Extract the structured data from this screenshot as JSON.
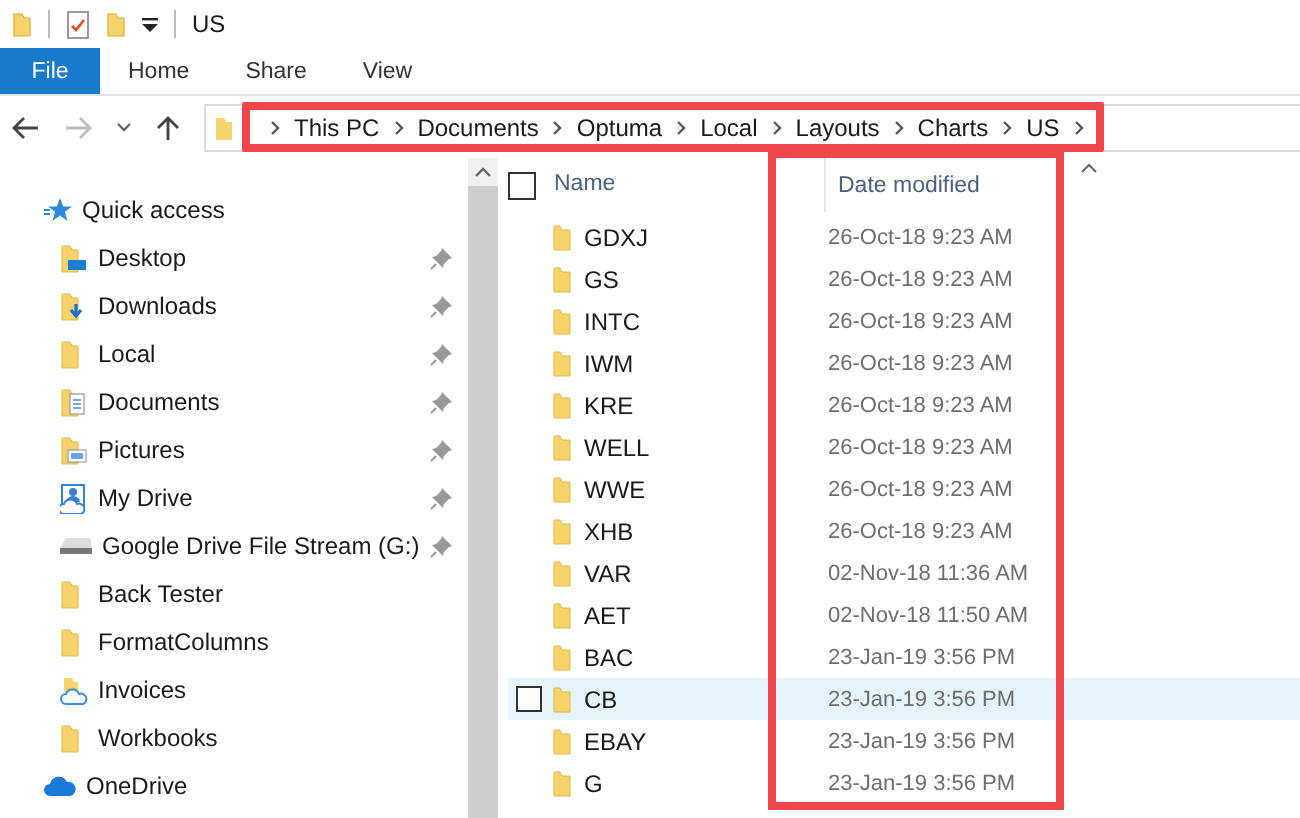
{
  "window": {
    "title": "US"
  },
  "ribbon_tabs": [
    {
      "label": "File",
      "selected": true
    },
    {
      "label": "Home",
      "selected": false
    },
    {
      "label": "Share",
      "selected": false
    },
    {
      "label": "View",
      "selected": false
    }
  ],
  "address_bar": {
    "highlighted": true,
    "segments": [
      "This PC",
      "Documents",
      "Optuma",
      "Local",
      "Layouts",
      "Charts",
      "US"
    ]
  },
  "sidebar": {
    "items": [
      {
        "label": "Quick access",
        "kind": "star",
        "children": [
          {
            "label": "Desktop",
            "kind": "desktop",
            "pinned": true
          },
          {
            "label": "Downloads",
            "kind": "downloads",
            "pinned": true
          },
          {
            "label": "Local",
            "kind": "folder",
            "pinned": true
          },
          {
            "label": "Documents",
            "kind": "documents",
            "pinned": true
          },
          {
            "label": "Pictures",
            "kind": "pictures",
            "pinned": true
          },
          {
            "label": "My Drive",
            "kind": "person",
            "pinned": true
          },
          {
            "label": "Google Drive File Stream (G:)",
            "kind": "drive",
            "pinned": true
          },
          {
            "label": "Back Tester",
            "kind": "folder",
            "pinned": false
          },
          {
            "label": "FormatColumns",
            "kind": "folder",
            "pinned": false
          },
          {
            "label": "Invoices",
            "kind": "cloud-folder",
            "pinned": false
          },
          {
            "label": "Workbooks",
            "kind": "folder",
            "pinned": false
          }
        ]
      },
      {
        "label": "OneDrive",
        "kind": "cloud"
      }
    ]
  },
  "table": {
    "all_selected": false,
    "columns": [
      {
        "label": "Name"
      },
      {
        "label": "Date modified"
      }
    ],
    "date_column_highlighted": true,
    "rows": [
      {
        "name": "GDXJ",
        "date": "26-Oct-18 9:23 AM",
        "selected": false
      },
      {
        "name": "GS",
        "date": "26-Oct-18 9:23 AM",
        "selected": false
      },
      {
        "name": "INTC",
        "date": "26-Oct-18 9:23 AM",
        "selected": false
      },
      {
        "name": "IWM",
        "date": "26-Oct-18 9:23 AM",
        "selected": false
      },
      {
        "name": "KRE",
        "date": "26-Oct-18 9:23 AM",
        "selected": false
      },
      {
        "name": "WELL",
        "date": "26-Oct-18 9:23 AM",
        "selected": false
      },
      {
        "name": "WWE",
        "date": "26-Oct-18 9:23 AM",
        "selected": false
      },
      {
        "name": "XHB",
        "date": "26-Oct-18 9:23 AM",
        "selected": false
      },
      {
        "name": "VAR",
        "date": "02-Nov-18 11:36 AM",
        "selected": false
      },
      {
        "name": "AET",
        "date": "02-Nov-18 11:50 AM",
        "selected": false
      },
      {
        "name": "BAC",
        "date": "23-Jan-19 3:56 PM",
        "selected": false
      },
      {
        "name": "CB",
        "date": "23-Jan-19 3:56 PM",
        "selected": true
      },
      {
        "name": "EBAY",
        "date": "23-Jan-19 3:56 PM",
        "selected": false
      },
      {
        "name": "G",
        "date": "23-Jan-19 3:56 PM",
        "selected": false
      }
    ]
  }
}
